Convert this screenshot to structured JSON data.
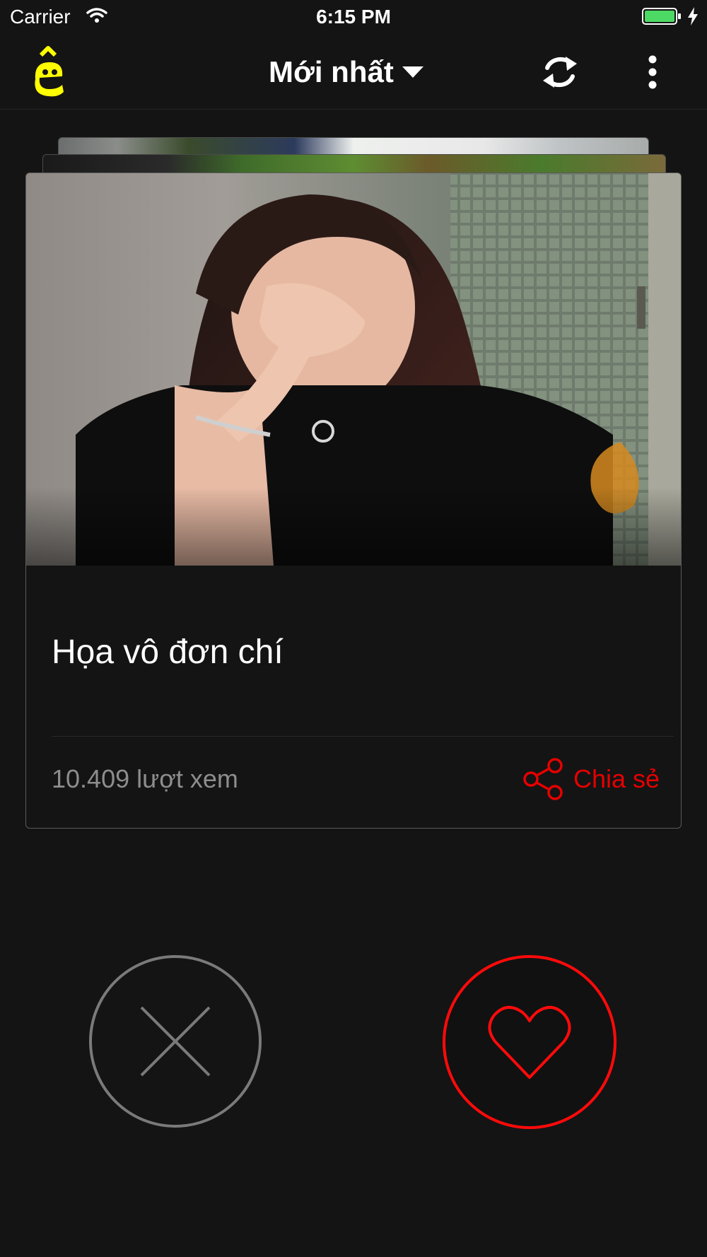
{
  "status_bar": {
    "carrier": "Carrier",
    "time": "6:15 PM",
    "battery_color": "#4cd964"
  },
  "nav": {
    "logo_icon": "e-face-logo-icon",
    "logo_color": "#ffff00",
    "title": "Mới nhất",
    "title_dropdown_icon": "caret-down-icon",
    "refresh_icon": "refresh-icon",
    "more_icon": "more-vertical-icon"
  },
  "card": {
    "title": "Họa vô đơn chí",
    "views": "10.409 lượt xem",
    "share_label": "Chia sẻ",
    "share_icon": "share-icon",
    "accent_color": "#e60000"
  },
  "actions": {
    "dislike_icon": "close-icon",
    "like_icon": "heart-icon",
    "like_color": "#ff0a0a",
    "dislike_color": "#7a7a7a"
  }
}
